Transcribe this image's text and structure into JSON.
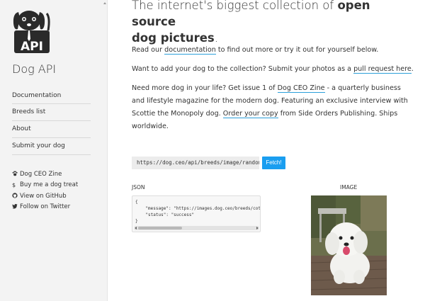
{
  "sidebar": {
    "brand": "Dog API",
    "logo_text": "API",
    "nav": [
      {
        "label": "Documentation"
      },
      {
        "label": "Breeds list"
      },
      {
        "label": "About"
      },
      {
        "label": "Submit your dog"
      }
    ],
    "extras": [
      {
        "icon": "paw-icon",
        "glyph": "🐾",
        "label": "Dog CEO Zine"
      },
      {
        "icon": "dollar-icon",
        "glyph": "$",
        "label": "Buy me a dog treat"
      },
      {
        "icon": "github-icon",
        "glyph": "●",
        "label": "View on GitHub"
      },
      {
        "icon": "twitter-icon",
        "glyph": "🐦",
        "label": "Follow on Twitter"
      }
    ]
  },
  "main": {
    "hero_prefix": "The internet's biggest collection of ",
    "hero_bold": "open source",
    "hero_bold2": "dog pictures",
    "hero_suffix": ".",
    "p1_a": "Read our ",
    "p1_link": "documentation",
    "p1_b": " to find out more or try it out for yourself below.",
    "p2_a": "Want to add your dog to the collection? Submit your photos as a ",
    "p2_link": "pull request here",
    "p2_b": ".",
    "p3_a": "Need more dog in your life? Get issue 1 of ",
    "p3_link1": "Dog CEO Zine",
    "p3_b": " - a quarterly business and lifestyle magazine for the modern dog. Featuring an exclusive interview with Scottie the Monopoly dog. ",
    "p3_link2": "Order your copy",
    "p3_c": " from Side Orders Publishing. Ships worldwide.",
    "url": "https://dog.ceo/api/breeds/image/random",
    "fetch_label": "Fetch!",
    "json_label": "JSON",
    "json_lines": [
      "{",
      "    \"message\": \"https://images.dog.ceo/breeds/cotondetulear/",
      "    \"status\": \"success\"",
      "}"
    ],
    "image_label": "IMAGE"
  },
  "colors": {
    "accent": "#1a9ef0",
    "sidebar_bg": "#f3f3f3",
    "link_underline": "#2b9fd9"
  }
}
